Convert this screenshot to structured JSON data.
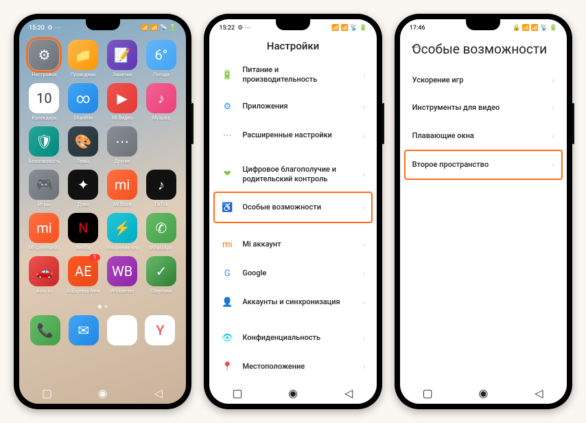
{
  "phone1": {
    "time": "15:20",
    "apps": [
      {
        "label": "Настройки",
        "icon": "⚙",
        "cls": "bg-grey",
        "hl": true
      },
      {
        "label": "Проводник",
        "icon": "📁",
        "cls": "bg-orange"
      },
      {
        "label": "Заметки",
        "icon": "📝",
        "cls": "bg-purple"
      },
      {
        "label": "Погода",
        "icon": "6°",
        "cls": "bg-weather"
      },
      {
        "label": "Календарь",
        "icon": "10",
        "cls": "bg-white"
      },
      {
        "label": "ShareMe",
        "icon": "∞",
        "cls": "bg-blue"
      },
      {
        "label": "Mi Видео",
        "icon": "▶",
        "cls": "bg-red"
      },
      {
        "label": "Музыка",
        "icon": "♪",
        "cls": "bg-pink"
      },
      {
        "label": "Безопасность",
        "icon": "🛡",
        "cls": "bg-teal"
      },
      {
        "label": "Темы",
        "icon": "🎨",
        "cls": "bg-dark"
      },
      {
        "label": "Другие",
        "icon": "⋯",
        "cls": "bg-grey"
      },
      {
        "label": "",
        "icon": "",
        "cls": ""
      },
      {
        "label": "Игры",
        "icon": "🎮",
        "cls": "bg-grey"
      },
      {
        "label": "Дзен",
        "icon": "✦",
        "cls": "bg-black"
      },
      {
        "label": "Mi Store",
        "icon": "mi",
        "cls": "bg-miorange"
      },
      {
        "label": "TikTok",
        "icon": "♪",
        "cls": "bg-black"
      },
      {
        "label": "Mi Community",
        "icon": "mi",
        "cls": "bg-miorange"
      },
      {
        "label": "Netflix",
        "icon": "N",
        "cls": "bg-netflix"
      },
      {
        "label": "Ускорение игр",
        "icon": "⚡",
        "cls": "bg-cyan"
      },
      {
        "label": "WhatsApp",
        "icon": "✆",
        "cls": "bg-whatsapp"
      },
      {
        "label": "Auto.ru",
        "icon": "🚗",
        "cls": "bg-autoru"
      },
      {
        "label": "AliExpress New",
        "icon": "AE",
        "cls": "bg-aliexp",
        "badge": "1"
      },
      {
        "label": "Wildberries",
        "icon": "WB",
        "cls": "bg-wb"
      },
      {
        "label": "Сбербанк",
        "icon": "✓",
        "cls": "bg-sber"
      }
    ],
    "dock": [
      {
        "label": "",
        "icon": "📞",
        "cls": "bg-phone"
      },
      {
        "label": "",
        "icon": "✉",
        "cls": "bg-msg"
      },
      {
        "label": "",
        "icon": "◉",
        "cls": "bg-chrome"
      },
      {
        "label": "",
        "icon": "Y",
        "cls": "bg-yandex"
      }
    ]
  },
  "phone2": {
    "time": "15:22",
    "title": "Настройки",
    "rows": [
      {
        "icon": "🔋",
        "color": "#4caf50",
        "label": "Питание и производительность"
      },
      {
        "icon": "⚙",
        "color": "#2196f3",
        "label": "Приложения"
      },
      {
        "icon": "⋯",
        "color": "#ff5722",
        "label": "Расширенные настройки"
      },
      {
        "gap": true
      },
      {
        "icon": "❤",
        "color": "#8bc34a",
        "label": "Цифровое благополучие и родительский контроль"
      },
      {
        "icon": "♿",
        "color": "#673ab7",
        "label": "Особые возможности",
        "hl": true
      },
      {
        "gap": true
      },
      {
        "icon": "mi",
        "color": "#ff6f00",
        "label": "Mi аккаунт"
      },
      {
        "icon": "G",
        "color": "#4285f4",
        "label": "Google"
      },
      {
        "icon": "👤",
        "color": "#2196f3",
        "label": "Аккаунты и синхронизация"
      },
      {
        "gap": true
      },
      {
        "icon": "👁",
        "color": "#00bcd4",
        "label": "Конфиденциальность"
      },
      {
        "icon": "📍",
        "color": "#2196f3",
        "label": "Местоположение"
      }
    ]
  },
  "phone3": {
    "time": "17:46",
    "title": "Особые возможности",
    "rows": [
      {
        "label": "Ускорение игр"
      },
      {
        "label": "Инструменты для видео"
      },
      {
        "label": "Плавающие окна"
      },
      {
        "label": "Второе пространство",
        "hl": true
      }
    ]
  }
}
